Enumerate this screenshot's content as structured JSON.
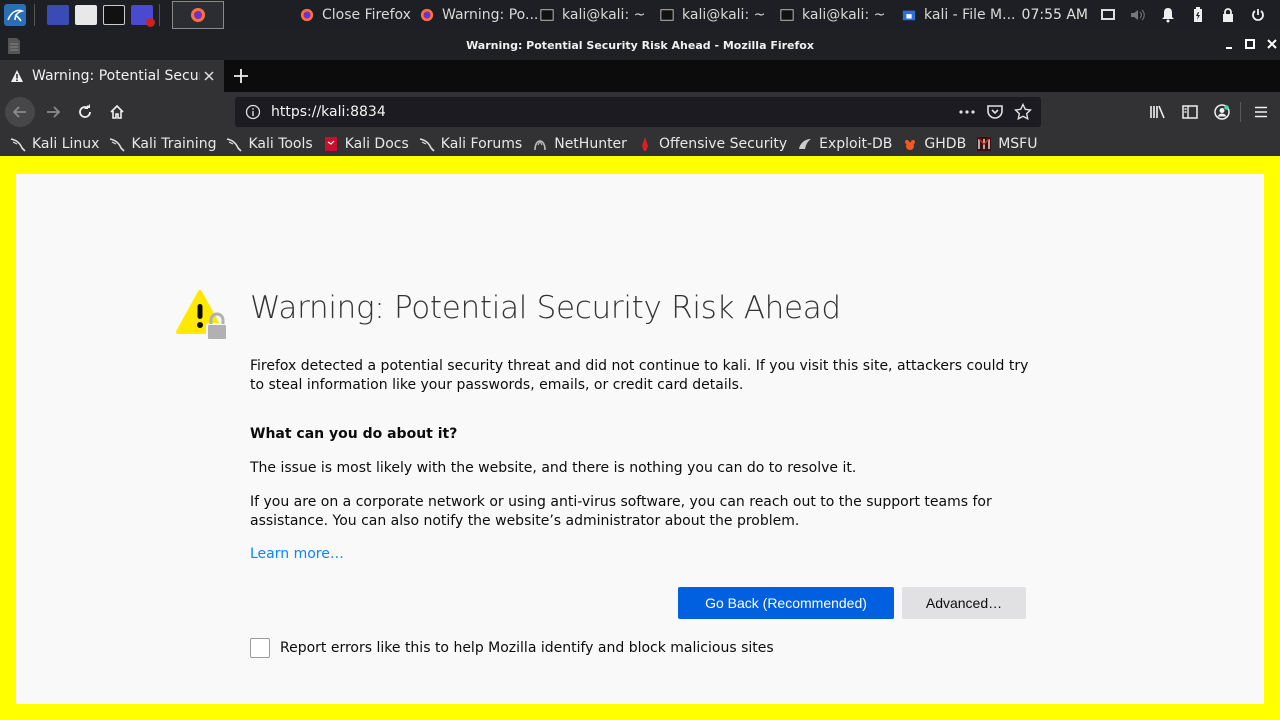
{
  "panel": {
    "tasks": [
      {
        "label": "Close Firefox",
        "icon": "firefox-icon"
      },
      {
        "label": "Warning: Po...",
        "icon": "firefox-icon"
      },
      {
        "label": "kali@kali: ~",
        "icon": "terminal-icon"
      },
      {
        "label": "kali@kali: ~",
        "icon": "terminal-icon"
      },
      {
        "label": "kali@kali: ~",
        "icon": "terminal-icon"
      },
      {
        "label": "kali - File M...",
        "icon": "file-manager-icon"
      }
    ],
    "clock": "07:55 AM"
  },
  "window": {
    "title": "Warning: Potential Security Risk Ahead - Mozilla Firefox"
  },
  "tab": {
    "label": "Warning: Potential Security Risk Ahead"
  },
  "nav": {
    "url": "https://kali:8834"
  },
  "bookmarks": [
    {
      "label": "Kali Linux",
      "icon": "kali-dragon-icon"
    },
    {
      "label": "Kali Training",
      "icon": "kali-dragon-icon"
    },
    {
      "label": "Kali Tools",
      "icon": "kali-dragon-icon"
    },
    {
      "label": "Kali Docs",
      "icon": "kali-docs-icon"
    },
    {
      "label": "Kali Forums",
      "icon": "kali-dragon-icon"
    },
    {
      "label": "NetHunter",
      "icon": "nethunter-icon"
    },
    {
      "label": "Offensive Security",
      "icon": "offsec-icon"
    },
    {
      "label": "Exploit-DB",
      "icon": "exploitdb-icon"
    },
    {
      "label": "GHDB",
      "icon": "ghdb-icon"
    },
    {
      "label": "MSFU",
      "icon": "msfu-icon"
    }
  ],
  "content": {
    "title": "Warning: Potential Security Risk Ahead",
    "intro": "Firefox detected a potential security threat and did not continue to kali. If you visit this site, attackers could try to steal information like your passwords, emails, or credit card details.",
    "heading": "What can you do about it?",
    "para1": "The issue is most likely with the website, and there is nothing you can do to resolve it.",
    "para2": "If you are on a corporate network or using anti-virus software, you can reach out to the support teams for assistance. You can also notify the website’s administrator about the problem.",
    "learn_more": "Learn more…",
    "go_back": "Go Back (Recommended)",
    "advanced": "Advanced…",
    "report": "Report errors like this to help Mozilla identify and block malicious sites"
  },
  "colors": {
    "accent": "#0060df",
    "link": "#0a84ff",
    "warning": "#ffe900",
    "frame": "#ffff00"
  }
}
